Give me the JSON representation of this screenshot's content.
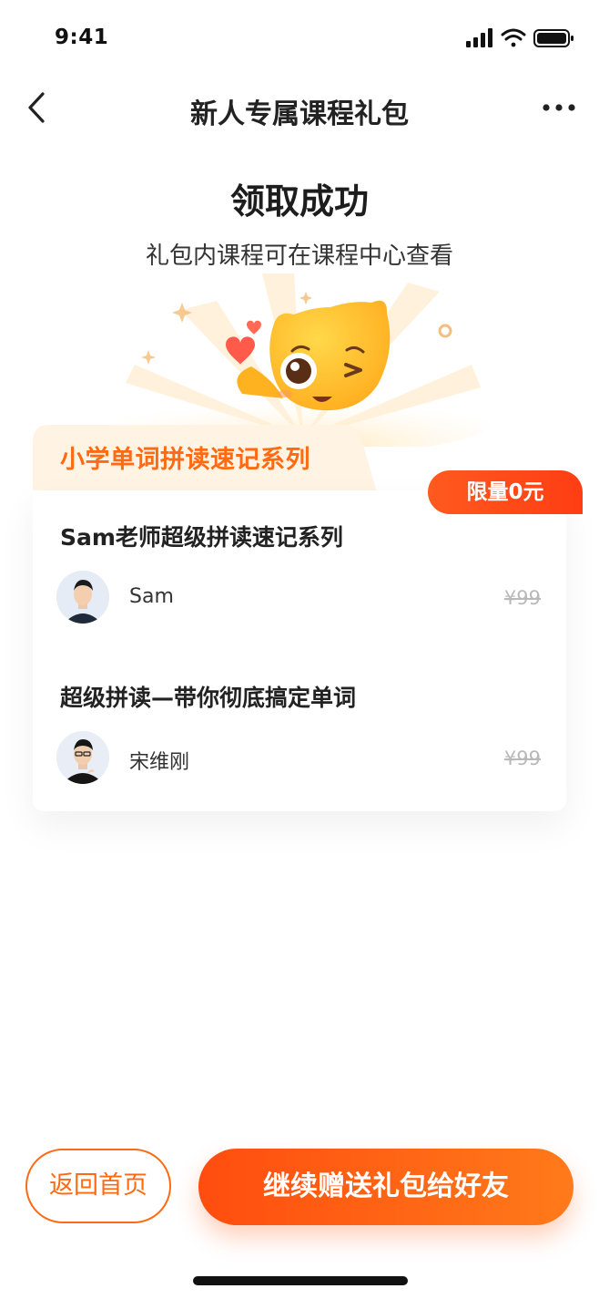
{
  "status_bar": {
    "time": "9:41"
  },
  "nav": {
    "title": "新人专属课程礼包"
  },
  "result": {
    "title": "领取成功",
    "subtitle": "礼包内课程可在课程中心查看"
  },
  "series": {
    "title": "小学单词拼读速记系列",
    "badge": "限量0元",
    "courses": [
      {
        "title": "Sam老师超级拼读速记系列",
        "teacher": "Sam",
        "price": "¥99"
      },
      {
        "title": "超级拼读—带你彻底搞定单词",
        "teacher": "宋维刚",
        "price": "¥99"
      }
    ]
  },
  "actions": {
    "home": "返回首页",
    "gift": "继续赠送礼包给好友"
  },
  "colors": {
    "accent": "#ff6a12",
    "badge": "#ff4a18",
    "tab_bg": "#fff3e3"
  }
}
